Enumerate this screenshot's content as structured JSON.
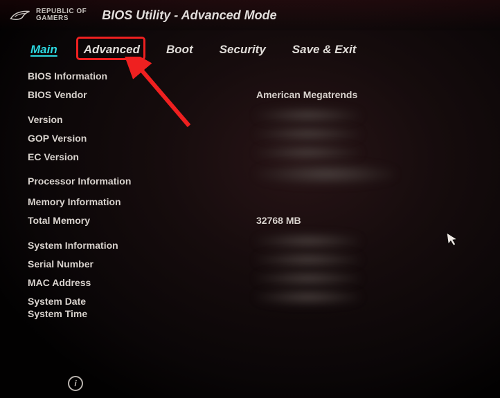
{
  "header": {
    "brand_line1": "REPUBLIC OF",
    "brand_line2": "GAMERS",
    "title": "BIOS Utility - Advanced Mode"
  },
  "tabs": {
    "main": "Main",
    "advanced": "Advanced",
    "boot": "Boot",
    "security": "Security",
    "save_exit": "Save & Exit"
  },
  "fields": {
    "bios_info": "BIOS Information",
    "bios_vendor_label": "BIOS Vendor",
    "bios_vendor_value": "American Megatrends",
    "version": "Version",
    "gop_version": "GOP Version",
    "ec_version": "EC Version",
    "processor_info": "Processor Information",
    "memory_info": "Memory Information",
    "total_memory_label": "Total Memory",
    "total_memory_value": "32768 MB",
    "system_info": "System Information",
    "serial_number": "Serial Number",
    "mac_address": "MAC Address",
    "system_date": "System Date",
    "system_time": "System Time"
  },
  "info_icon_glyph": "i"
}
